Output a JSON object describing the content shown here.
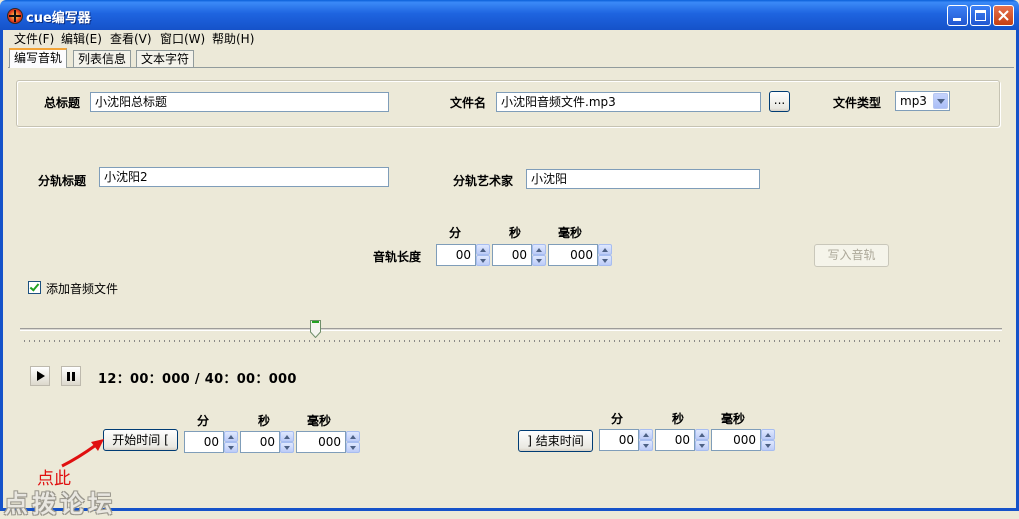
{
  "window": {
    "title": "cue编写器"
  },
  "menu": [
    "文件(F)",
    "编辑(E)",
    "查看(V)",
    "窗口(W)",
    "帮助(H)"
  ],
  "tabs": [
    "编写音轨",
    "列表信息",
    "文本字符"
  ],
  "album": {
    "title_label": "总标题",
    "title_value": "小沈阳总标题",
    "file_label": "文件名",
    "file_value": "小沈阳音频文件.mp3",
    "browse_label": "...",
    "type_label": "文件类型",
    "type_value": "mp3"
  },
  "track": {
    "title_label": "分轨标题",
    "title_value": "小沈阳2",
    "artist_label": "分轨艺术家",
    "artist_value": "小沈阳"
  },
  "length": {
    "label": "音轨长度",
    "minute_head": "分",
    "second_head": "秒",
    "ms_head": "毫秒",
    "minute": "00",
    "second": "00",
    "ms": "000",
    "write_button": "写入音轨"
  },
  "add_audio": {
    "label": "添加音频文件",
    "checked": true
  },
  "player": {
    "time": "12：00：000 / 40：00：000",
    "slider_fraction": 0.3
  },
  "start": {
    "button": "开始时间 [",
    "minute_head": "分",
    "second_head": "秒",
    "ms_head": "毫秒",
    "minute": "00",
    "second": "00",
    "ms": "000"
  },
  "end": {
    "button": "] 结束时间",
    "minute_head": "分",
    "second_head": "秒",
    "ms_head": "毫秒",
    "minute": "00",
    "second": "00",
    "ms": "000"
  },
  "annotation": "点此",
  "watermark": "点拨论坛",
  "colors": {
    "titlebar": "#1552c9",
    "annotation": "#e01010",
    "face": "#ece9d8"
  }
}
